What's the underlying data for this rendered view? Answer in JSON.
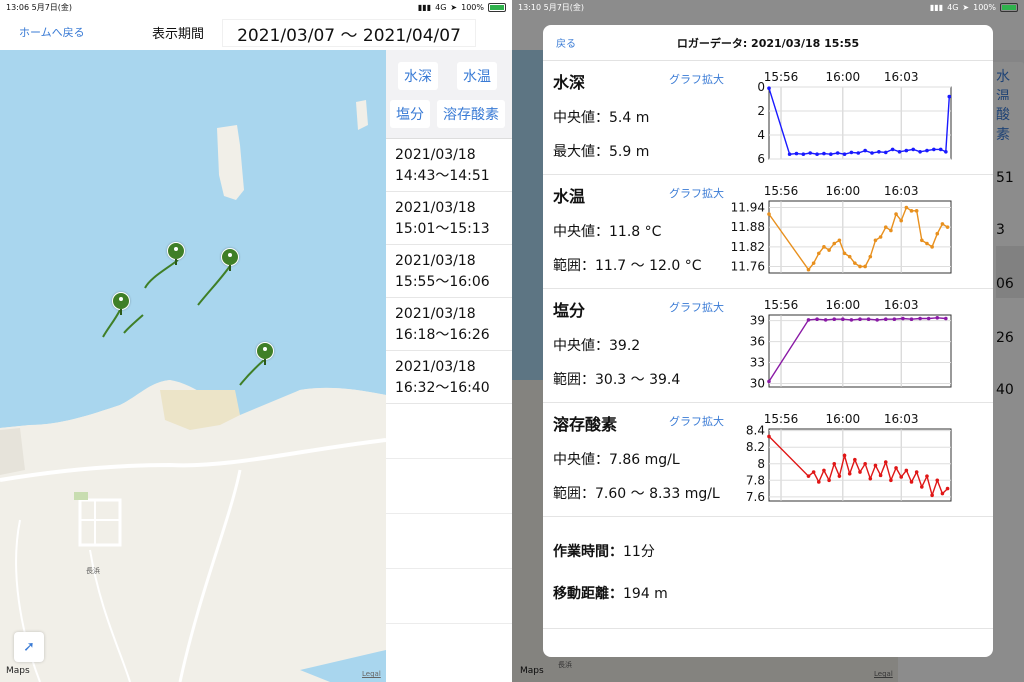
{
  "left": {
    "status": {
      "time": "13:06",
      "date": "5月7日(金)",
      "network": "4G",
      "battery": "100%"
    },
    "nav": {
      "back_label": "ホームへ戻る",
      "period_label": "表示期間",
      "period_value": "2021/03/07 〜 2021/04/07"
    },
    "tabs": [
      "水深",
      "水温",
      "塩分",
      "溶存酸素"
    ],
    "dates": [
      {
        "line1": "2021/03/18",
        "line2": "14:43〜14:51"
      },
      {
        "line1": "2021/03/18",
        "line2": "15:01〜15:13"
      },
      {
        "line1": "2021/03/18",
        "line2": "15:55〜16:06"
      },
      {
        "line1": "2021/03/18",
        "line2": "16:18〜16:26"
      },
      {
        "line1": "2021/03/18",
        "line2": "16:32〜16:40"
      }
    ],
    "map": {
      "place_label": "長浜",
      "brand": "Maps",
      "legal": "Legal"
    }
  },
  "right": {
    "status": {
      "time": "13:10",
      "date": "5月7日(金)",
      "network": "4G",
      "battery": "100%"
    },
    "modal": {
      "back_label": "戻る",
      "title": "ロガーデータ: 2021/03/18 15:55",
      "zoom_label": "グラフ拡大",
      "sections": [
        {
          "title": "水深",
          "stat1": "中央値：5.4 m",
          "stat2": "最大値：5.9 m"
        },
        {
          "title": "水温",
          "stat1": "中央値：11.8 °C",
          "stat2": "範囲：11.7 〜 12.0 °C"
        },
        {
          "title": "塩分",
          "stat1": "中央値：39.2",
          "stat2": "範囲：30.3 〜 39.4"
        },
        {
          "title": "溶存酸素",
          "stat1": "中央値：7.86 mg/L",
          "stat2": "範囲：7.60 〜 8.33 mg/L"
        }
      ],
      "work_time_label": "作業時間：",
      "work_time_value": "11分",
      "distance_label": "移動距離：",
      "distance_value": "194 m"
    },
    "behind": {
      "b1": "水温",
      "b2": "酸素",
      "d1": "51",
      "d2": "3",
      "d3": "06",
      "d4": "26",
      "d5": "40",
      "brand": "Maps",
      "legal": "Legal",
      "place": "長浜"
    }
  },
  "chart_data": [
    {
      "type": "line",
      "title": "水深",
      "color": "#1a1aff",
      "reversed_y": true,
      "x_ticks": [
        "15:56",
        "16:00",
        "16:03"
      ],
      "y_ticks": [
        0,
        2,
        4,
        6
      ],
      "ylim": [
        0,
        6
      ],
      "x_minutes": [
        0,
        1.2,
        1.6,
        2,
        2.4,
        2.8,
        3.2,
        3.6,
        4,
        4.4,
        4.8,
        5.2,
        5.6,
        6,
        6.4,
        6.8,
        7.2,
        7.6,
        8,
        8.4,
        8.8,
        9.2,
        9.6,
        10,
        10.3,
        10.5
      ],
      "values": [
        0.1,
        5.6,
        5.55,
        5.6,
        5.5,
        5.6,
        5.55,
        5.6,
        5.5,
        5.6,
        5.45,
        5.5,
        5.3,
        5.5,
        5.4,
        5.45,
        5.2,
        5.4,
        5.3,
        5.2,
        5.4,
        5.3,
        5.2,
        5.2,
        5.4,
        0.8
      ]
    },
    {
      "type": "line",
      "title": "水温",
      "color": "#e8901e",
      "x_ticks": [
        "15:56",
        "16:00",
        "16:03"
      ],
      "y_ticks": [
        11.94,
        11.88,
        11.82,
        11.76
      ],
      "ylim": [
        11.74,
        11.96
      ],
      "x_minutes": [
        0,
        2.3,
        2.6,
        2.9,
        3.2,
        3.5,
        3.8,
        4.1,
        4.4,
        4.7,
        5,
        5.3,
        5.6,
        5.9,
        6.2,
        6.5,
        6.8,
        7.1,
        7.4,
        7.7,
        8,
        8.3,
        8.6,
        8.9,
        9.2,
        9.5,
        9.8,
        10.1,
        10.4
      ],
      "values": [
        11.92,
        11.75,
        11.77,
        11.8,
        11.82,
        11.81,
        11.83,
        11.84,
        11.8,
        11.79,
        11.77,
        11.76,
        11.76,
        11.79,
        11.84,
        11.85,
        11.88,
        11.87,
        11.92,
        11.9,
        11.94,
        11.93,
        11.93,
        11.84,
        11.83,
        11.82,
        11.86,
        11.89,
        11.88
      ]
    },
    {
      "type": "line",
      "title": "塩分",
      "color": "#8a1aa6",
      "x_ticks": [
        "15:56",
        "16:00",
        "16:03"
      ],
      "y_ticks": [
        39,
        36,
        33,
        30
      ],
      "ylim": [
        29.5,
        39.8
      ],
      "x_minutes": [
        0,
        2.3,
        2.8,
        3.3,
        3.8,
        4.3,
        4.8,
        5.3,
        5.8,
        6.3,
        6.8,
        7.3,
        7.8,
        8.3,
        8.8,
        9.3,
        9.8,
        10.3
      ],
      "values": [
        30.3,
        39.1,
        39.2,
        39.1,
        39.2,
        39.2,
        39.1,
        39.2,
        39.2,
        39.1,
        39.2,
        39.2,
        39.3,
        39.2,
        39.3,
        39.3,
        39.4,
        39.3
      ]
    },
    {
      "type": "line",
      "title": "溶存酸素",
      "color": "#e01616",
      "x_ticks": [
        "15:56",
        "16:00",
        "16:03"
      ],
      "y_ticks": [
        8.4,
        8.2,
        8.0,
        7.8,
        7.6
      ],
      "ylim": [
        7.55,
        8.42
      ],
      "x_minutes": [
        0,
        2.3,
        2.6,
        2.9,
        3.2,
        3.5,
        3.8,
        4.1,
        4.4,
        4.7,
        5,
        5.3,
        5.6,
        5.9,
        6.2,
        6.5,
        6.8,
        7.1,
        7.4,
        7.7,
        8,
        8.3,
        8.6,
        8.9,
        9.2,
        9.5,
        9.8,
        10.1,
        10.4
      ],
      "values": [
        8.33,
        7.85,
        7.9,
        7.78,
        7.92,
        7.8,
        8.0,
        7.85,
        8.1,
        7.88,
        8.05,
        7.9,
        8.0,
        7.82,
        7.98,
        7.86,
        8.02,
        7.8,
        7.95,
        7.84,
        7.92,
        7.78,
        7.9,
        7.72,
        7.85,
        7.62,
        7.8,
        7.64,
        7.7
      ]
    }
  ]
}
